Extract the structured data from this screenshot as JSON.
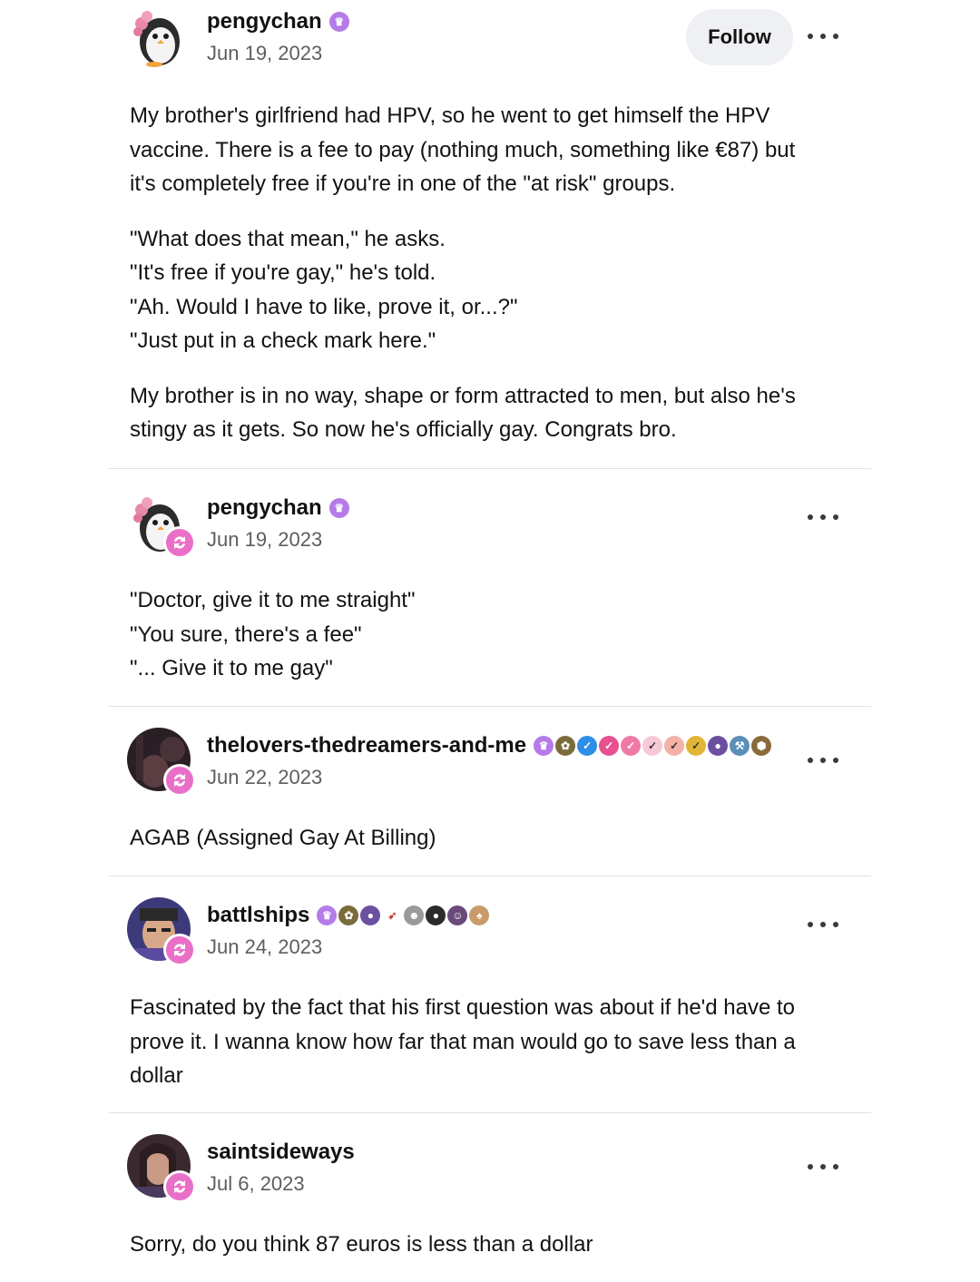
{
  "posts": [
    {
      "username": "pengychan",
      "date": "Jun 19, 2023",
      "follow_label": "Follow",
      "avatar": "penguin-avatar",
      "paragraphs": [
        [
          "My brother's girlfriend had HPV, so he went to get himself the HPV",
          "vaccine. There is a fee to pay (nothing much, something like €87) but",
          "it's completely free if you're in one of the \"at risk\" groups."
        ],
        [
          "\"What does that mean,\" he asks.",
          "\"It's free if you're gay,\" he's told.",
          "\"Ah. Would I have to like, prove it, or...?\"",
          "\"Just put in a check mark here.\""
        ],
        [
          "My brother is in no way, shape or form attracted to men, but also he's",
          "stingy as it gets. So now he's officially gay. Congrats bro."
        ]
      ]
    },
    {
      "username": "pengychan",
      "date": "Jun 19, 2023",
      "avatar": "penguin-avatar",
      "paragraphs": [
        [
          "\"Doctor, give it to me straight\"",
          "\"You sure, there's a fee\"",
          "\"... Give it to me gay\""
        ]
      ]
    },
    {
      "username": "thelovers-thedreamers-and-me",
      "date": "Jun 22, 2023",
      "avatar": "dark-photo-avatar",
      "paragraphs": [
        [
          "AGAB (Assigned Gay At Billing)"
        ]
      ]
    },
    {
      "username": "battlships",
      "date": "Jun 24, 2023",
      "avatar": "selfie-avatar",
      "paragraphs": [
        [
          "Fascinated by the fact that his first question was about if he'd have to",
          "prove it. I wanna know how far that man would go to save less than a",
          "dollar"
        ]
      ]
    },
    {
      "username": "saintsideways",
      "date": "Jul 6, 2023",
      "avatar": "portrait-avatar",
      "paragraphs": [
        [
          "Sorry, do you think 87 euros is less than a dollar"
        ]
      ]
    }
  ],
  "colors": {
    "reblog_badge": "#ea6fc9",
    "badge_purple": "#b57be8",
    "badge_blue": "#2f8fe8",
    "badge_pink": "#e8508f",
    "badge_gold": "#e3b536"
  }
}
